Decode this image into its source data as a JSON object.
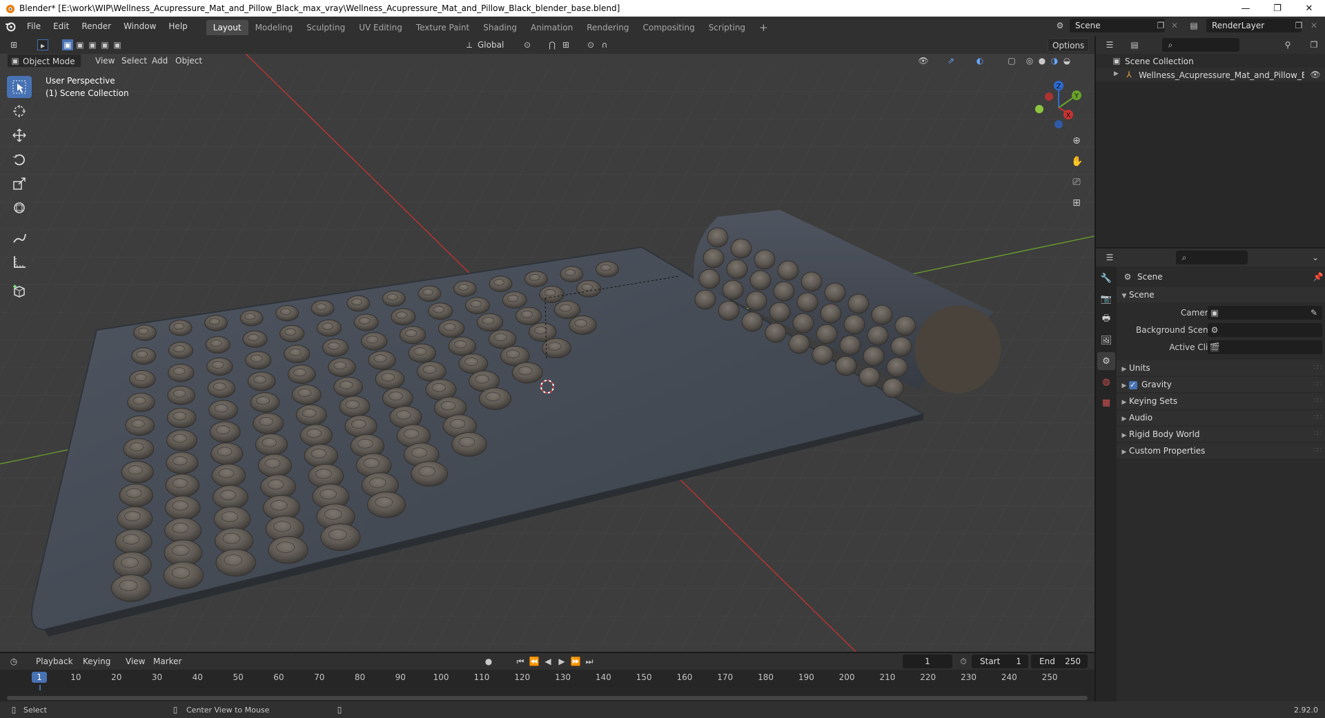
{
  "window": {
    "title": "Blender* [E:\\work\\WIP\\Wellness_Acupressure_Mat_and_Pillow_Black_max_vray\\Wellness_Acupressure_Mat_and_Pillow_Black_blender_base.blend]",
    "minimize": "—",
    "restore": "❐",
    "close": "✕"
  },
  "menu": {
    "items": [
      "File",
      "Edit",
      "Render",
      "Window",
      "Help"
    ]
  },
  "workspaces": {
    "tabs": [
      "Layout",
      "Modeling",
      "Sculpting",
      "UV Editing",
      "Texture Paint",
      "Shading",
      "Animation",
      "Rendering",
      "Compositing",
      "Scripting"
    ],
    "add": "+",
    "active_index": 0
  },
  "scene_selector": {
    "value": "Scene"
  },
  "view_layer": {
    "value": "RenderLayer"
  },
  "viewport_header": {
    "mode": "Object Mode",
    "menus": [
      "View",
      "Select",
      "Add",
      "Object"
    ],
    "transform_orientation": "Global",
    "options": "Options"
  },
  "viewport": {
    "perspective": "User Perspective",
    "collection": "(1) Scene Collection",
    "gizmo": {
      "x": "X",
      "y": "Y",
      "z": "Z"
    }
  },
  "outliner": {
    "root": "Scene Collection",
    "items": [
      "Wellness_Acupressure_Mat_and_Pillow_Blac"
    ]
  },
  "properties": {
    "context": "Scene",
    "panel": "Scene",
    "fields": {
      "camera": "Camera",
      "background_scene": "Background Scene",
      "active_clip": "Active Clip"
    },
    "sections": [
      "Units",
      "Gravity",
      "Keying Sets",
      "Audio",
      "Rigid Body World",
      "Custom Properties"
    ],
    "gravity_checked": true
  },
  "timeline": {
    "menus": [
      "Playback",
      "Keying",
      "View",
      "Marker"
    ],
    "current_frame": "1",
    "start_label": "Start",
    "start": "1",
    "end_label": "End",
    "end": "250",
    "ticks": [
      "1",
      "10",
      "20",
      "30",
      "40",
      "50",
      "60",
      "70",
      "80",
      "90",
      "100",
      "110",
      "120",
      "130",
      "140",
      "150",
      "160",
      "170",
      "180",
      "190",
      "200",
      "210",
      "220",
      "230",
      "240",
      "250"
    ]
  },
  "statusbar": {
    "select": "Select",
    "center_view": "Center View to Mouse",
    "version": "2.92.0"
  },
  "colors": {
    "accent": "#4772b3",
    "viewport_bg": "#3d3d3d",
    "x_axis": "#c83232",
    "y_axis": "#6aa32a",
    "mat": "#454c56",
    "nub": "#6a645e"
  }
}
